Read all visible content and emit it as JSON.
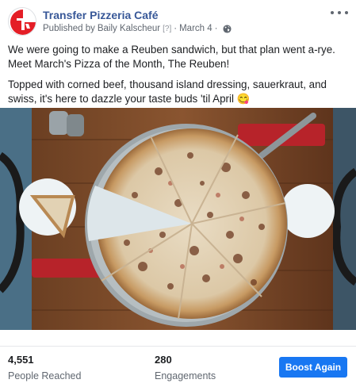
{
  "page": {
    "name": "Transfer Pizzeria Café",
    "published_by_label": "Published by",
    "publisher": "Baily Kalscheur",
    "help_marker": "[?]",
    "date": "March 4",
    "avatar_icon": "transfer-pizzeria-logo",
    "privacy_icon": "globe-icon"
  },
  "post": {
    "paragraph_1": "We were going to make a Reuben sandwich, but that plan went a-rye. Meet March's Pizza of the Month, The Reuben!",
    "paragraph_2": "Topped with corned beef, thousand island dressing, sauerkraut, and swiss, it's here to dazzle your taste buds 'til April 😋"
  },
  "stats": {
    "reached_value": "4,551",
    "reached_label": "People Reached",
    "engagements_value": "280",
    "engagements_label": "Engagements"
  },
  "actions": {
    "boost_label": "Boost Again",
    "more_icon": "more-options-icon"
  },
  "colors": {
    "link": "#385898",
    "button": "#1877f2",
    "logo_red": "#e41e26"
  }
}
